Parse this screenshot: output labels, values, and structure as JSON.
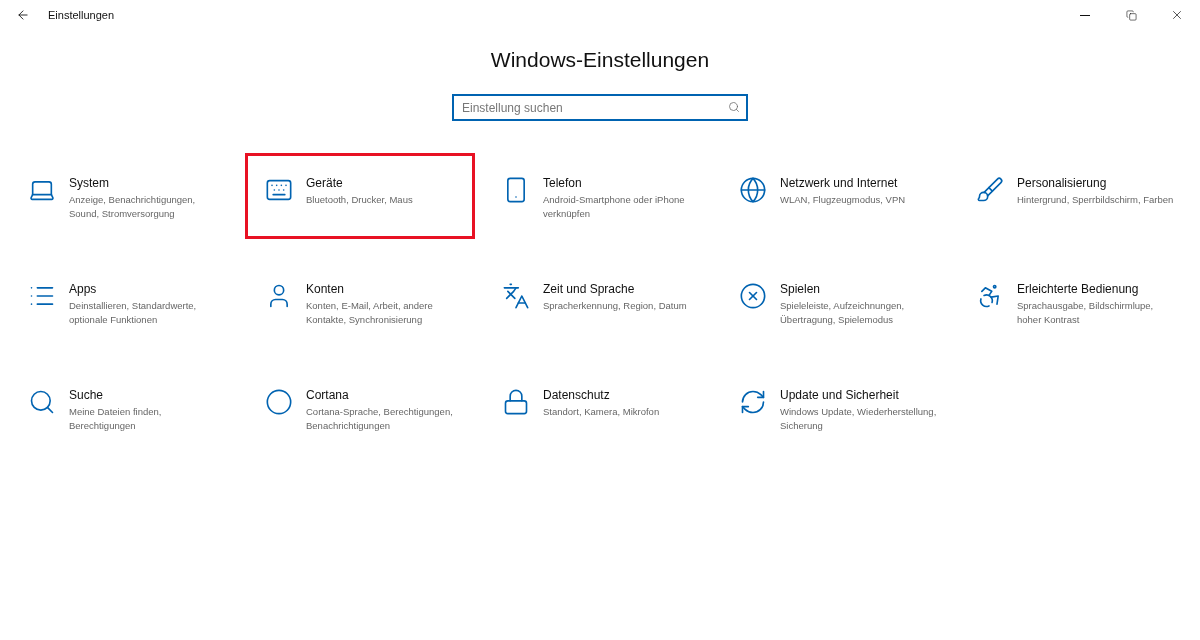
{
  "window": {
    "title": "Einstellungen"
  },
  "heading": "Windows-Einstellungen",
  "search": {
    "placeholder": "Einstellung suchen"
  },
  "tiles": [
    {
      "name": "System",
      "description": "Anzeige, Benachrichtigungen, Sound, Stromversorgung",
      "highlighted": false
    },
    {
      "name": "Geräte",
      "description": "Bluetooth, Drucker, Maus",
      "highlighted": true
    },
    {
      "name": "Telefon",
      "description": "Android-Smartphone oder iPhone verknüpfen",
      "highlighted": false
    },
    {
      "name": "Netzwerk und Internet",
      "description": "WLAN, Flugzeugmodus, VPN",
      "highlighted": false
    },
    {
      "name": "Personalisierung",
      "description": "Hintergrund, Sperrbildschirm, Farben",
      "highlighted": false
    },
    {
      "name": "Apps",
      "description": "Deinstallieren, Standardwerte, optionale Funktionen",
      "highlighted": false
    },
    {
      "name": "Konten",
      "description": "Konten, E-Mail, Arbeit, andere Kontakte, Synchronisierung",
      "highlighted": false
    },
    {
      "name": "Zeit und Sprache",
      "description": "Spracherkennung, Region, Datum",
      "highlighted": false
    },
    {
      "name": "Spielen",
      "description": "Spieleleiste, Aufzeichnungen, Übertragung, Spielemodus",
      "highlighted": false
    },
    {
      "name": "Erleichterte Bedienung",
      "description": "Sprachausgabe, Bildschirmlupe, hoher Kontrast",
      "highlighted": false
    },
    {
      "name": "Suche",
      "description": "Meine Dateien finden, Berechtigungen",
      "highlighted": false
    },
    {
      "name": "Cortana",
      "description": "Cortana-Sprache, Berechtigungen, Benachrichtigungen",
      "highlighted": false
    },
    {
      "name": "Datenschutz",
      "description": "Standort, Kamera, Mikrofon",
      "highlighted": false
    },
    {
      "name": "Update und Sicherheit",
      "description": "Windows Update, Wiederherstellung, Sicherung",
      "highlighted": false
    }
  ]
}
